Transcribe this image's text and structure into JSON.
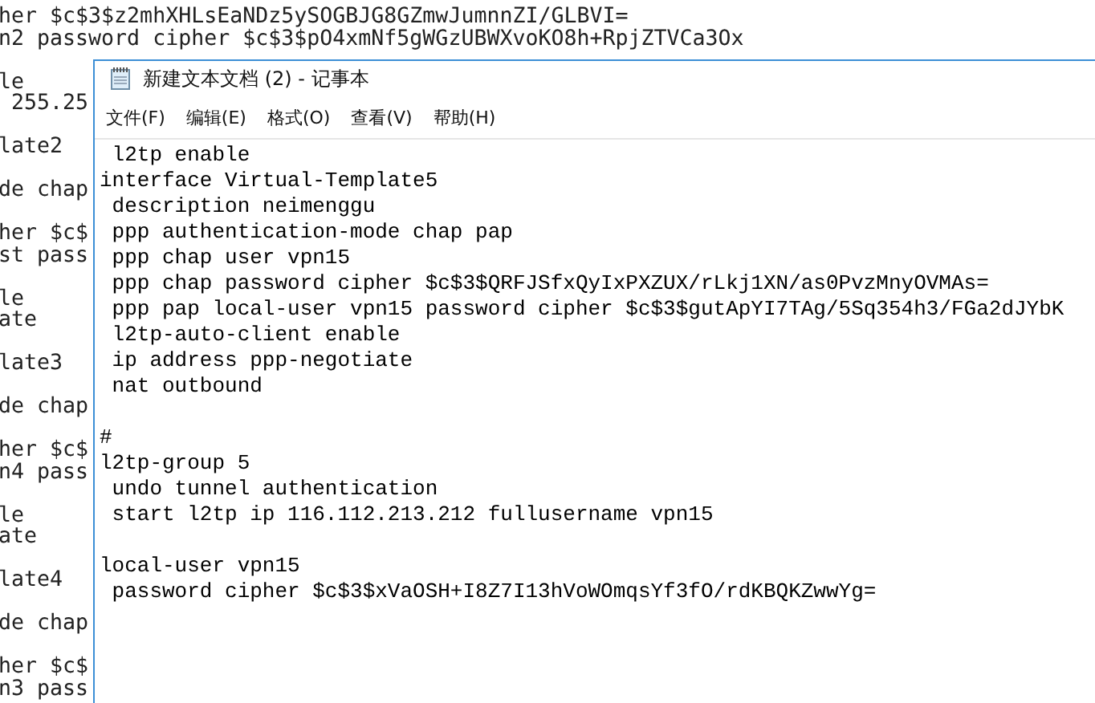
{
  "background_text": {
    "blocks": [
      [
        "her $c$3$z2mhXHLsEaNDz5ySOGBJG8GZmwJumnnZI/GLBVI=",
        "n2 password cipher $c$3$pO4xmNf5gWGzUBWXvoKO8h+RpjZTVCa3Ox"
      ],
      [
        "le",
        " 255.25"
      ],
      [
        "late2"
      ],
      [
        "de chap"
      ],
      [
        "her $c$",
        "st pass"
      ],
      [
        "le",
        "ate"
      ],
      [
        "late3"
      ],
      [
        "de chap"
      ],
      [
        "her $c$",
        "n4 pass"
      ],
      [
        "le",
        "ate"
      ],
      [
        "late4"
      ],
      [
        "de chap"
      ],
      [
        "her $c$",
        "n3 pass"
      ]
    ]
  },
  "window": {
    "title": "新建文本文档 (2) - 记事本",
    "menu": [
      "文件(F)",
      "编辑(E)",
      "格式(O)",
      "查看(V)",
      "帮助(H)"
    ],
    "paragraphs": [
      [
        " l2tp enable",
        "interface Virtual-Template5",
        " description neimenggu",
        " ppp authentication-mode chap pap",
        " ppp chap user vpn15",
        " ppp chap password cipher $c$3$QRFJSfxQyIxPXZUX/rLkj1XN/as0PvzMnyOVMAs=",
        " ppp pap local-user vpn15 password cipher $c$3$gutApYI7TAg/5Sq354h3/FGa2dJYbK",
        " l2tp-auto-client enable",
        " ip address ppp-negotiate",
        " nat outbound"
      ],
      [
        "#",
        "l2tp-group 5",
        " undo tunnel authentication",
        " start l2tp ip 116.112.213.212 fullusername vpn15"
      ],
      [
        "local-user vpn15",
        " password cipher $c$3$xVaOSH+I8Z7I13hVoWOmqsYf3fO/rdKBQKZwwYg="
      ]
    ]
  }
}
